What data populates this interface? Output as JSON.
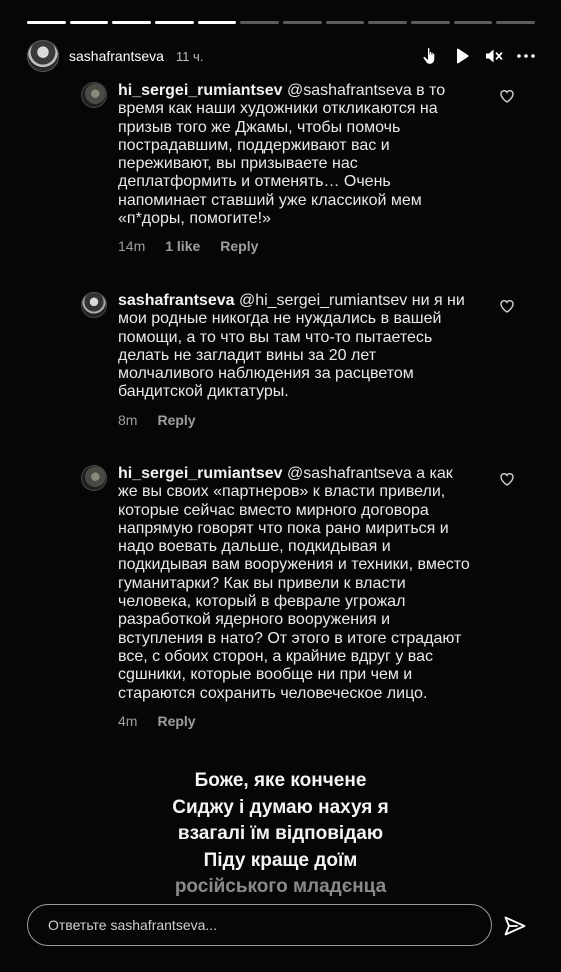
{
  "story": {
    "progress": {
      "total": 12,
      "done": 5
    },
    "username": "sashafrantseva",
    "time": "11 ч.",
    "header_icons": [
      "hand-pointer-icon",
      "play-icon",
      "mute-icon",
      "more-icon"
    ]
  },
  "comments": [
    {
      "username": "hi_sergei_rumiantsev",
      "text": " @sashafrantseva в то время как наши художники откликаются на призыв того же Джамы, чтобы помочь пострадавшим, поддерживают вас и переживают, вы призываете нас деплатформить и отменять… Очень напоминает ставший уже классикой мем «п*доры, помогите!»",
      "time": "14m",
      "likes": "1 like",
      "reply": "Reply"
    },
    {
      "username": "sashafrantseva",
      "text": " @hi_sergei_rumiantsev ни я ни мои родные никогда не нуждались в вашей помощи, а то что вы там что-то пытаетесь делать не загладит вины за 20 лет молчаливого наблюдения за расцветом бандитской диктатуры.",
      "time": "8m",
      "reply": "Reply"
    },
    {
      "username": "hi_sergei_rumiantsev",
      "text": " @sashafrantseva а как же вы своих «партнеров» к власти привели, которые сейчас вместо мирного договора напрямую говорят что пока рано мириться и надо воевать дальше, подкидывая и подкидывая вам вооружения и техники, вместо гуманитарки? Как вы привели к власти человека, который в феврале угрожал разработкой ядерного вооружения и вступления в нато? От этого в итоге страдают все, с обоих сторон, а крайние вдруг у вас сgшники, которые вообще ни при чем и стараются сохранить человеческое лицо.",
      "time": "4m",
      "reply": "Reply"
    }
  ],
  "overlay_lines": [
    "Боже, яке кончене",
    "Сиджу і думаю нахуя я",
    "взагалі їм відповідаю",
    "Піду краще доїм",
    "російського младєнца"
  ],
  "reply_bar": {
    "placeholder": "Ответьте sashafrantseva..."
  },
  "colors": {
    "background": "#060606",
    "text": "#e9e9e9",
    "muted": "#9e9e9e"
  }
}
